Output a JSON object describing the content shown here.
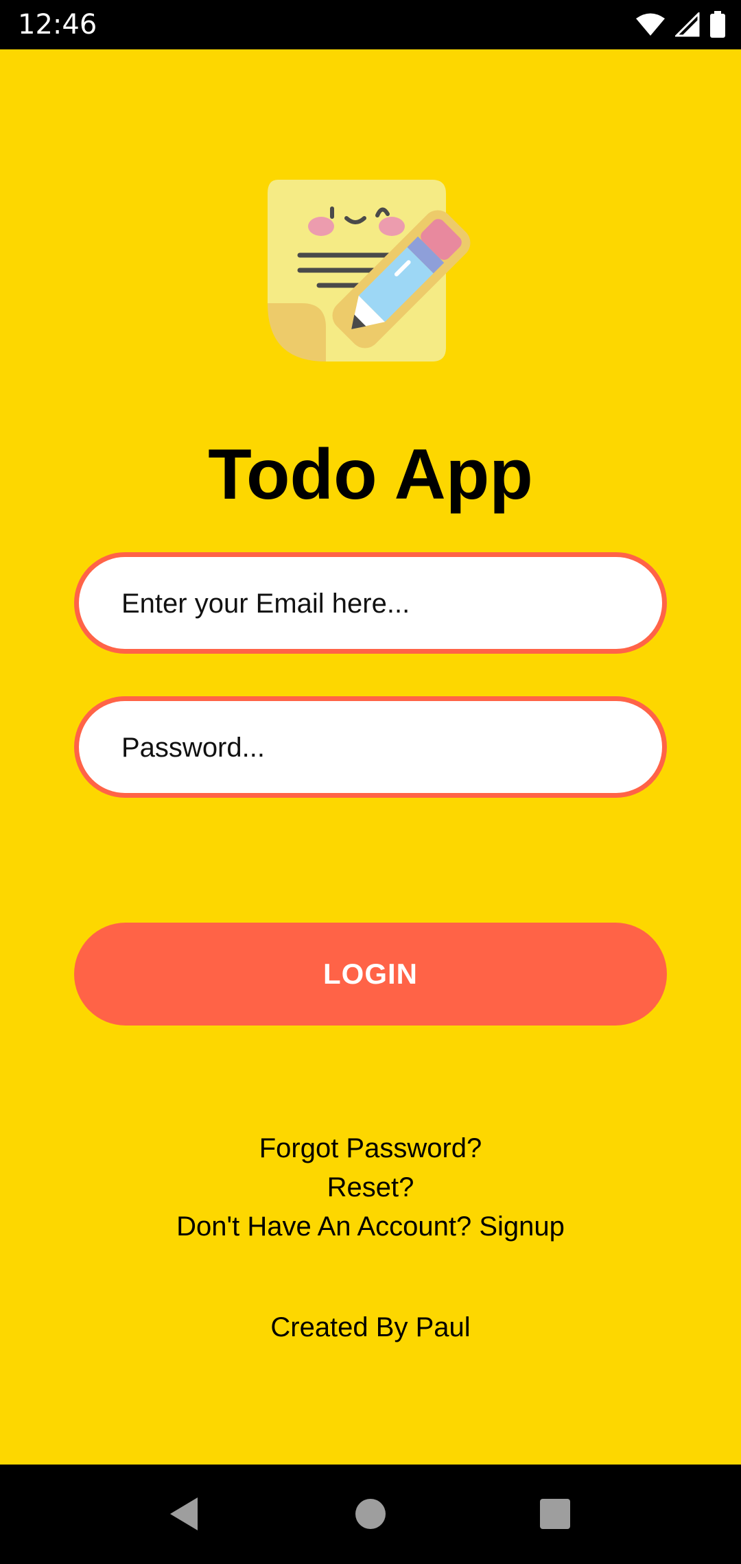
{
  "status_bar": {
    "time": "12:46",
    "icons": [
      "wifi-icon",
      "cellular-signal-icon",
      "battery-icon"
    ]
  },
  "app": {
    "title": "Todo App",
    "logo": "sticky-note-pencil-logo",
    "email_placeholder": "Enter your Email here...",
    "password_placeholder": "Password...",
    "login_label": "LOGIN",
    "forgot_password": "Forgot Password?",
    "reset": "Reset?",
    "signup": "Don't Have An Account? Signup",
    "credit": "Created By Paul"
  },
  "nav_bar": {
    "icons": [
      "back-icon",
      "home-icon",
      "recents-icon"
    ]
  },
  "colors": {
    "background": "#FDD700",
    "accent": "#FF6347",
    "input_background": "#FFFFFF"
  }
}
